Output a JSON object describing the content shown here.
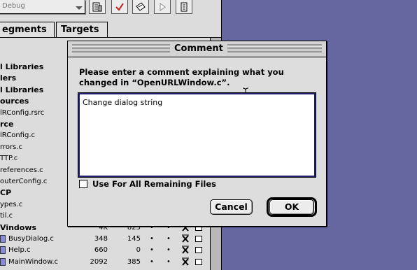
{
  "project_window": {
    "target_popup": "Debug",
    "tabs": [
      {
        "label": "egments"
      },
      {
        "label": "Targets"
      }
    ],
    "files": [
      {
        "name": "l Libraries",
        "group": true
      },
      {
        "name": "lers",
        "group": true
      },
      {
        "name": "l Libraries",
        "group": true
      },
      {
        "name": "ources",
        "group": true
      },
      {
        "name": "lRConfig.rsrc",
        "group": false
      },
      {
        "name": "rce",
        "group": true
      },
      {
        "name": "lRConfig.c",
        "group": false
      },
      {
        "name": "rrors.c",
        "group": false
      },
      {
        "name": "TTP.c",
        "group": false
      },
      {
        "name": "references.c",
        "group": false
      },
      {
        "name": "outerConfig.c",
        "group": false
      },
      {
        "name": "CP",
        "group": true
      },
      {
        "name": "ypes.c",
        "group": false
      },
      {
        "name": "til.c",
        "group": false
      },
      {
        "name": "Vindows",
        "group": true,
        "code": "4K",
        "data": "825"
      },
      {
        "name": "BusyDialog.c",
        "group": false,
        "icon": true,
        "code": "348",
        "data": "145"
      },
      {
        "name": "Help.c",
        "group": false,
        "icon": true,
        "code": "660",
        "data": "0"
      },
      {
        "name": "MainWindow.c",
        "group": false,
        "icon": true,
        "code": "2092",
        "data": "385"
      }
    ]
  },
  "dialog": {
    "title": "Comment",
    "message_line1": "Please enter a comment explaining what you",
    "message_line2": "changed in “OpenURLWindow.c”.",
    "comment_value": "Change dialog string",
    "checkbox_label": "Use For All Remaining Files",
    "checkbox_checked": false,
    "cancel_label": "Cancel",
    "ok_label": "OK"
  },
  "colors": {
    "desktop": "#6666a0",
    "field_border": "#20206e"
  }
}
